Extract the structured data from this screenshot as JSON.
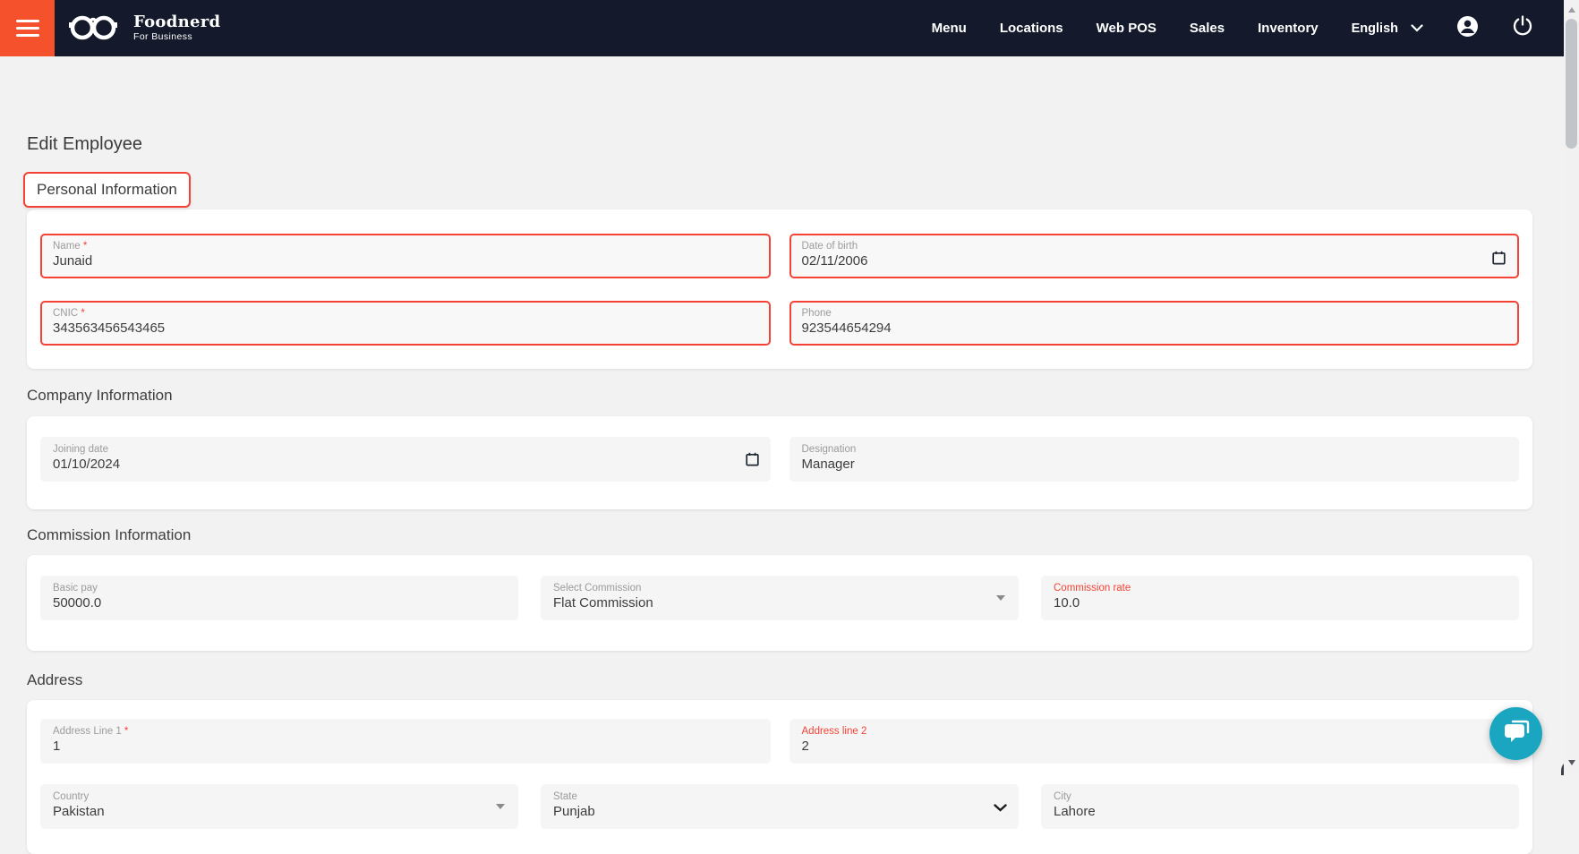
{
  "navbar": {
    "brand": {
      "name": "Foodnerd",
      "tagline": "For Business"
    },
    "links": [
      {
        "label": "Menu"
      },
      {
        "label": "Locations"
      },
      {
        "label": "Web POS"
      },
      {
        "label": "Sales"
      },
      {
        "label": "Inventory"
      }
    ],
    "language": "English"
  },
  "page": {
    "title": "Edit Employee"
  },
  "sections": {
    "personal": {
      "title": "Personal Information",
      "fields": {
        "name": {
          "label": "Name",
          "required": "*",
          "value": "Junaid"
        },
        "dob": {
          "label": "Date of birth",
          "value": "02/11/2006"
        },
        "cnic": {
          "label": "CNIC",
          "required": "*",
          "value": "343563456543465"
        },
        "phone": {
          "label": "Phone",
          "value": "923544654294"
        }
      }
    },
    "company": {
      "title": "Company Information",
      "fields": {
        "joining_date": {
          "label": "Joining date",
          "value": "01/10/2024"
        },
        "designation": {
          "label": "Designation",
          "value": "Manager"
        }
      }
    },
    "commission": {
      "title": "Commission Information",
      "fields": {
        "basic_pay": {
          "label": "Basic pay",
          "value": "50000.0"
        },
        "select_commission": {
          "label": "Select Commission",
          "value": "Flat Commission"
        },
        "commission_rate": {
          "label": "Commission rate",
          "value": "10.0"
        }
      }
    },
    "address": {
      "title": "Address",
      "fields": {
        "line1": {
          "label": "Address Line 1",
          "required": "*",
          "value": "1"
        },
        "line2": {
          "label": "Address line 2",
          "value": "2"
        },
        "country": {
          "label": "Country",
          "value": "Pakistan"
        },
        "state": {
          "label": "State",
          "value": "Punjab"
        },
        "city": {
          "label": "City",
          "value": "Lahore"
        }
      }
    }
  },
  "colors": {
    "accent_orange": "#f4512c",
    "navbar_bg": "#141a2b",
    "error_red": "#f44336",
    "chat_teal": "#1aa6c0"
  }
}
